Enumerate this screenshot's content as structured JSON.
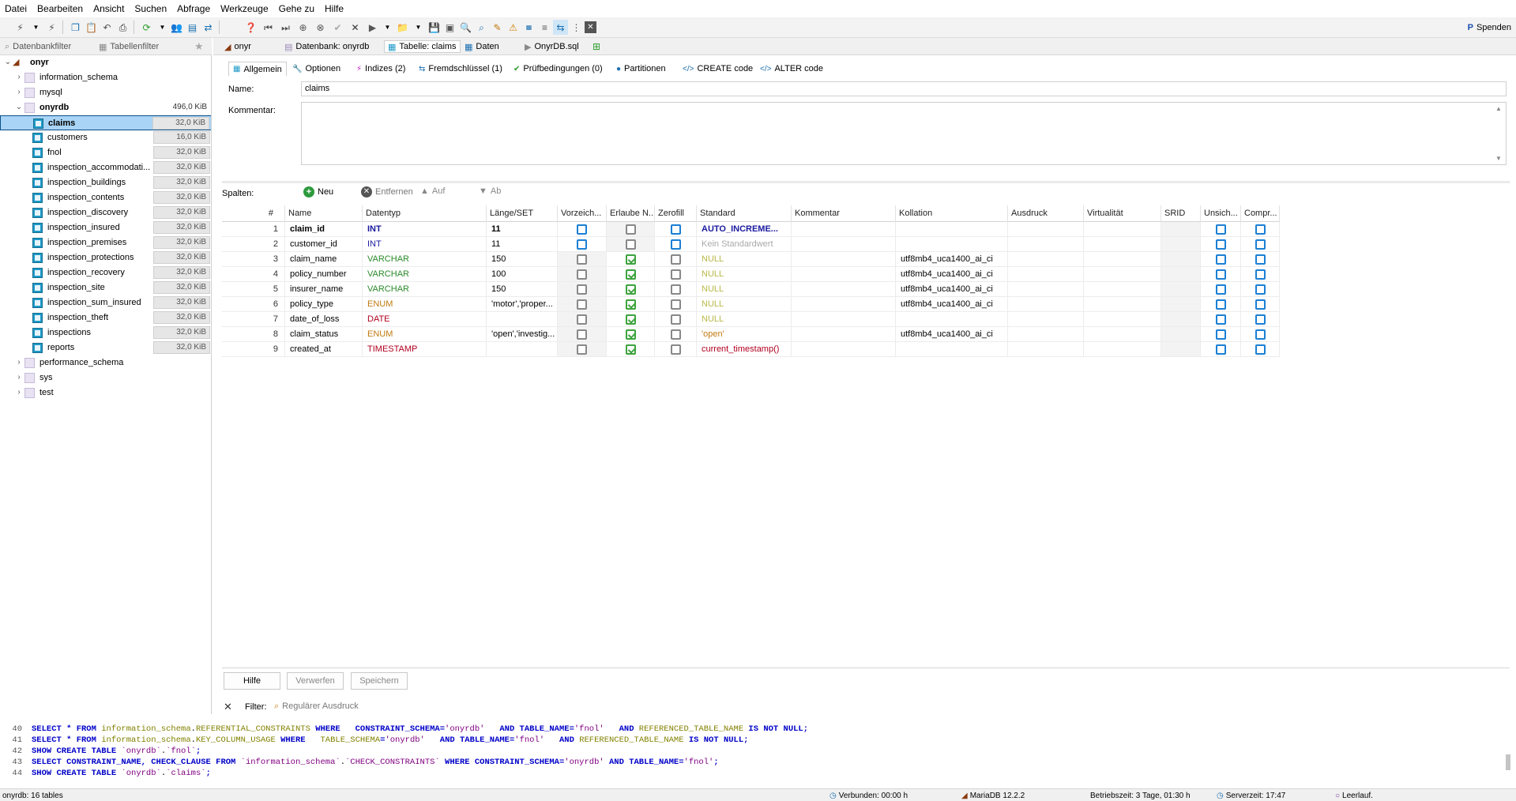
{
  "menu": [
    "Datei",
    "Bearbeiten",
    "Ansicht",
    "Suchen",
    "Abfrage",
    "Werkzeuge",
    "Gehe zu",
    "Hilfe"
  ],
  "toolbar": {
    "donate_label": "Spenden"
  },
  "left_tabs": {
    "db_filter": "Datenbankfilter",
    "table_filter": "Tabellenfilter"
  },
  "tree": {
    "root": "onyr",
    "databases_top": [
      "information_schema",
      "mysql"
    ],
    "current_db": {
      "name": "onyrdb",
      "size": "496,0 KiB"
    },
    "tables": [
      {
        "name": "claims",
        "size": "32,0 KiB"
      },
      {
        "name": "customers",
        "size": "16,0 KiB"
      },
      {
        "name": "fnol",
        "size": "32,0 KiB"
      },
      {
        "name": "inspection_accommodati...",
        "size": "32,0 KiB"
      },
      {
        "name": "inspection_buildings",
        "size": "32,0 KiB"
      },
      {
        "name": "inspection_contents",
        "size": "32,0 KiB"
      },
      {
        "name": "inspection_discovery",
        "size": "32,0 KiB"
      },
      {
        "name": "inspection_insured",
        "size": "32,0 KiB"
      },
      {
        "name": "inspection_premises",
        "size": "32,0 KiB"
      },
      {
        "name": "inspection_protections",
        "size": "32,0 KiB"
      },
      {
        "name": "inspection_recovery",
        "size": "32,0 KiB"
      },
      {
        "name": "inspection_site",
        "size": "32,0 KiB"
      },
      {
        "name": "inspection_sum_insured",
        "size": "32,0 KiB"
      },
      {
        "name": "inspection_theft",
        "size": "32,0 KiB"
      },
      {
        "name": "inspections",
        "size": "32,0 KiB"
      },
      {
        "name": "reports",
        "size": "32,0 KiB"
      }
    ],
    "databases_bottom": [
      "performance_schema",
      "sys",
      "test"
    ]
  },
  "doc_tabs": [
    "onyr",
    "Datenbank: onyrdb",
    "Tabelle: claims",
    "Daten",
    "OnyrDB.sql"
  ],
  "sub_tabs": [
    "Allgemein",
    "Optionen",
    "Indizes (2)",
    "Fremdschlüssel (1)",
    "Prüfbedingungen (0)",
    "Partitionen",
    "CREATE code",
    "ALTER code"
  ],
  "form": {
    "name_label": "Name:",
    "name_value": "claims",
    "comment_label": "Kommentar:",
    "comment_value": ""
  },
  "columns_toolbar": {
    "label": "Spalten:",
    "new": "Neu",
    "remove": "Entfernen",
    "up": "Auf",
    "down": "Ab"
  },
  "grid": {
    "headers": [
      "#",
      "Name",
      "Datentyp",
      "Länge/SET",
      "Vorzeich...",
      "Erlaube N...",
      "Zerofill",
      "Standard",
      "Kommentar",
      "Kollation",
      "Ausdruck",
      "Virtualität",
      "SRID",
      "Unsich...",
      "Compr..."
    ],
    "rows": [
      {
        "num": "1",
        "name": "claim_id",
        "type": "INT",
        "length": "11",
        "unsigned": false,
        "null": false,
        "zerofill": false,
        "default": "AUTO_INCREME...",
        "collation": ""
      },
      {
        "num": "2",
        "name": "customer_id",
        "type": "INT",
        "length": "11",
        "unsigned": false,
        "null": false,
        "zerofill": false,
        "default": "Kein Standardwert",
        "collation": ""
      },
      {
        "num": "3",
        "name": "claim_name",
        "type": "VARCHAR",
        "length": "150",
        "unsigned": false,
        "null": true,
        "zerofill": false,
        "default": "NULL",
        "collation": "utf8mb4_uca1400_ai_ci"
      },
      {
        "num": "4",
        "name": "policy_number",
        "type": "VARCHAR",
        "length": "100",
        "unsigned": false,
        "null": true,
        "zerofill": false,
        "default": "NULL",
        "collation": "utf8mb4_uca1400_ai_ci"
      },
      {
        "num": "5",
        "name": "insurer_name",
        "type": "VARCHAR",
        "length": "150",
        "unsigned": false,
        "null": true,
        "zerofill": false,
        "default": "NULL",
        "collation": "utf8mb4_uca1400_ai_ci"
      },
      {
        "num": "6",
        "name": "policy_type",
        "type": "ENUM",
        "length": "'motor','proper...",
        "unsigned": false,
        "null": true,
        "zerofill": false,
        "default": "NULL",
        "collation": "utf8mb4_uca1400_ai_ci"
      },
      {
        "num": "7",
        "name": "date_of_loss",
        "type": "DATE",
        "length": "",
        "unsigned": false,
        "null": true,
        "zerofill": false,
        "default": "NULL",
        "collation": ""
      },
      {
        "num": "8",
        "name": "claim_status",
        "type": "ENUM",
        "length": "'open','investig...",
        "unsigned": false,
        "null": true,
        "zerofill": false,
        "default": "'open'",
        "collation": "utf8mb4_uca1400_ai_ci"
      },
      {
        "num": "9",
        "name": "created_at",
        "type": "TIMESTAMP",
        "length": "",
        "unsigned": false,
        "null": true,
        "zerofill": false,
        "default": "current_timestamp()",
        "collation": ""
      }
    ]
  },
  "buttons": {
    "help": "Hilfe",
    "discard": "Verwerfen",
    "save": "Speichern"
  },
  "filter": {
    "label": "Filter:",
    "placeholder": "Regulärer Ausdruck"
  },
  "sql_lines": [
    {
      "n": "40",
      "parts": [
        [
          "kw",
          "SELECT * FROM "
        ],
        [
          "id",
          "information_schema"
        ],
        [
          "t",
          "."
        ],
        [
          "id",
          "REFERENTIAL_CONSTRAINTS"
        ],
        [
          "kw",
          " WHERE   CONSTRAINT_SCHEMA="
        ],
        [
          "str",
          "'onyrdb'"
        ],
        [
          "kw",
          "   AND TABLE_NAME="
        ],
        [
          "str",
          "'fnol'"
        ],
        [
          "kw",
          "   AND "
        ],
        [
          "id",
          "REFERENCED_TABLE_NAME"
        ],
        [
          "kw",
          " IS NOT NULL;"
        ]
      ]
    },
    {
      "n": "41",
      "parts": [
        [
          "kw",
          "SELECT * FROM "
        ],
        [
          "id",
          "information_schema"
        ],
        [
          "t",
          "."
        ],
        [
          "id",
          "KEY_COLUMN_USAGE"
        ],
        [
          "kw",
          " WHERE   "
        ],
        [
          "id",
          "TABLE_SCHEMA"
        ],
        [
          "kw",
          "="
        ],
        [
          "str",
          "'onyrdb'"
        ],
        [
          "kw",
          "   AND TABLE_NAME="
        ],
        [
          "str",
          "'fnol'"
        ],
        [
          "kw",
          "   AND "
        ],
        [
          "id",
          "REFERENCED_TABLE_NAME"
        ],
        [
          "kw",
          " IS NOT NULL;"
        ]
      ]
    },
    {
      "n": "42",
      "parts": [
        [
          "kw",
          "SHOW CREATE TABLE "
        ],
        [
          "str",
          "`onyrdb`"
        ],
        [
          "t",
          "."
        ],
        [
          "str",
          "`fnol`"
        ],
        [
          "kw",
          ";"
        ]
      ]
    },
    {
      "n": "43",
      "parts": [
        [
          "kw",
          "SELECT CONSTRAINT_NAME, CHECK_CLAUSE FROM "
        ],
        [
          "str",
          "`information_schema`"
        ],
        [
          "t",
          "."
        ],
        [
          "str",
          "`CHECK_CONSTRAINTS`"
        ],
        [
          "kw",
          " WHERE CONSTRAINT_SCHEMA="
        ],
        [
          "str",
          "'onyrdb'"
        ],
        [
          "kw",
          " AND TABLE_NAME="
        ],
        [
          "str",
          "'fnol'"
        ],
        [
          "kw",
          ";"
        ]
      ]
    },
    {
      "n": "44",
      "parts": [
        [
          "kw",
          "SHOW CREATE TABLE "
        ],
        [
          "str",
          "`onyrdb`"
        ],
        [
          "t",
          "."
        ],
        [
          "str",
          "`claims`"
        ],
        [
          "kw",
          ";"
        ]
      ]
    }
  ],
  "status": {
    "left": "onyrdb: 16 tables",
    "connected": "Verbunden: 00:00 h",
    "server": "MariaDB 12.2.2",
    "uptime": "Betriebszeit: 3 Tage, 01:30 h",
    "server_time": "Serverzeit: 17:47",
    "idle": "Leerlauf."
  }
}
